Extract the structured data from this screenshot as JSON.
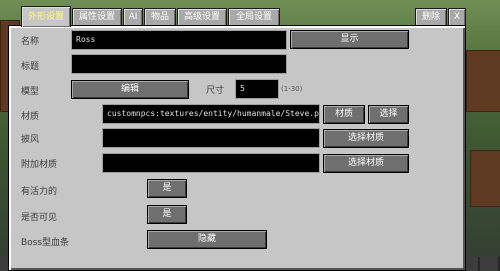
{
  "tabs": {
    "appearance": "外形设置",
    "attributes": "属性设置",
    "ai": "AI",
    "items": "物品",
    "advanced": "高级设置",
    "global": "全局设置",
    "delete": "删除",
    "close": "X"
  },
  "name": {
    "label": "名称",
    "value": "Ross",
    "show_button": "显示"
  },
  "title": {
    "label": "标题",
    "value": ""
  },
  "model": {
    "label": "模型",
    "edit_button": "编辑",
    "size_label": "尺寸",
    "size_value": "5",
    "size_range": "(1-30)"
  },
  "texture": {
    "label": "材质",
    "value": "customnpcs:textures/entity/humanmale/Steve.png",
    "texture_button": "材质",
    "select_button": "选择"
  },
  "cape": {
    "label": "披风",
    "value": "",
    "select_button": "选择材质"
  },
  "overlay": {
    "label": "附加材质",
    "value": "",
    "select_button": "选择材质"
  },
  "living": {
    "label": "有活力的",
    "value": "是"
  },
  "visible": {
    "label": "是否可见",
    "value": "是"
  },
  "boss_bar": {
    "label": "Boss型血条",
    "value": "隐藏"
  },
  "colors": {
    "panel": "#c6c6c6",
    "button": "#6f6f6f",
    "active_tab_text": "#ffff66",
    "field": "#000000"
  }
}
